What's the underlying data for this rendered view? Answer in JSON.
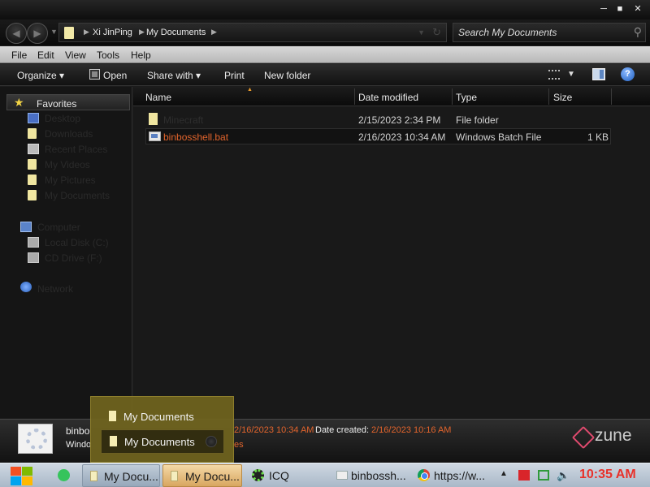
{
  "address": {
    "crumbs": [
      "Xi JinPing",
      "My Documents"
    ]
  },
  "search": {
    "placeholder": "Search My Documents"
  },
  "menubar": {
    "items": [
      "File",
      "Edit",
      "View",
      "Tools",
      "Help"
    ]
  },
  "toolbar": {
    "organize": "Organize",
    "open": "Open",
    "share": "Share with",
    "print": "Print",
    "new_folder": "New folder"
  },
  "navpane": {
    "favorites": "Favorites",
    "items": [
      {
        "label": "Desktop",
        "icon": "desktop-icon"
      },
      {
        "label": "Downloads",
        "icon": "folder-icon"
      },
      {
        "label": "Recent Places",
        "icon": "recent-places-icon"
      },
      {
        "label": "My Videos",
        "icon": "folder-icon"
      },
      {
        "label": "My Pictures",
        "icon": "folder-icon"
      },
      {
        "label": "My Documents",
        "icon": "folder-icon"
      }
    ],
    "computer": "Computer",
    "drives": [
      "Local Disk (C:)",
      "CD Drive (F:)"
    ],
    "network": "Network"
  },
  "columns": [
    "Name",
    "Date modified",
    "Type",
    "Size"
  ],
  "files": [
    {
      "name": "Minecraft",
      "date": "2/15/2023 2:34 PM",
      "type": "File folder",
      "size": ""
    },
    {
      "name": "binbosshell.bat",
      "date": "2/16/2023 10:34 AM",
      "type": "Windows Batch File",
      "size": "1 KB"
    }
  ],
  "details": {
    "name_partial": "binbo",
    "type_partial": "Windo",
    "modified_partial": "2/16/2023 10:34 AM",
    "created_key": "Date created:",
    "created_value": "2/16/2023 10:16 AM",
    "size_partial": "es",
    "brand": "zune"
  },
  "popup": {
    "items": [
      "My Documents",
      "My Documents"
    ]
  },
  "taskbar": {
    "buttons": [
      "My Docu...",
      "My Docu...",
      "ICQ",
      "binbossh...",
      "https://w..."
    ],
    "clock": "10:35 AM"
  },
  "colors": {
    "accent_orange": "#e2642c",
    "clock_red": "#e8312a",
    "popup": "#70641e"
  }
}
